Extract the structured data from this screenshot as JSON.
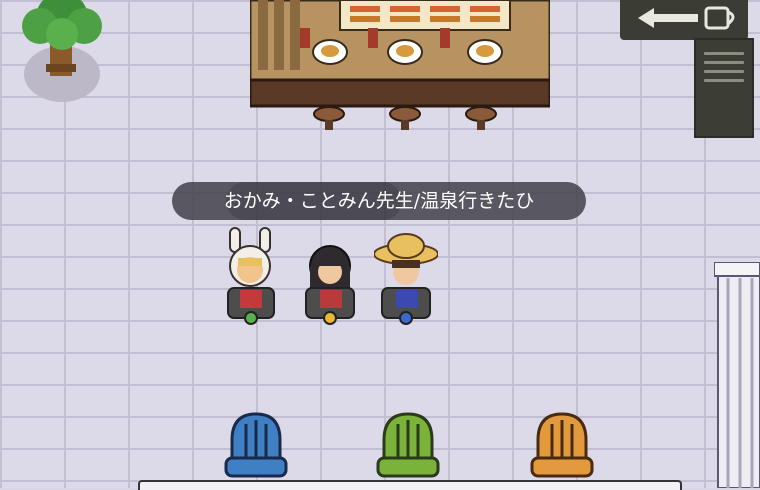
{
  "player": {
    "name_tag": "おかみ・ことみん先生/温泉行きたひ"
  },
  "colors": {
    "floor": "#dcd9e8",
    "grout": "#c3bfd2",
    "name_tag_bg": "#3c3a44",
    "chair_blue": "#3f7fc4",
    "chair_green": "#7bb23a",
    "chair_orange": "#e39a3c"
  },
  "avatars": [
    {
      "kind": "bunny-hood-avatar",
      "kart_color": "green"
    },
    {
      "kind": "dark-hair-avatar",
      "kart_color": "yellow"
    },
    {
      "kind": "straw-hat-avatar",
      "kart_color": "blue"
    }
  ],
  "chairs": [
    {
      "color": "blue"
    },
    {
      "color": "green"
    },
    {
      "color": "orange"
    }
  ],
  "icons": {
    "exit_sign": "arrow-left-coffee-cup-icon"
  }
}
